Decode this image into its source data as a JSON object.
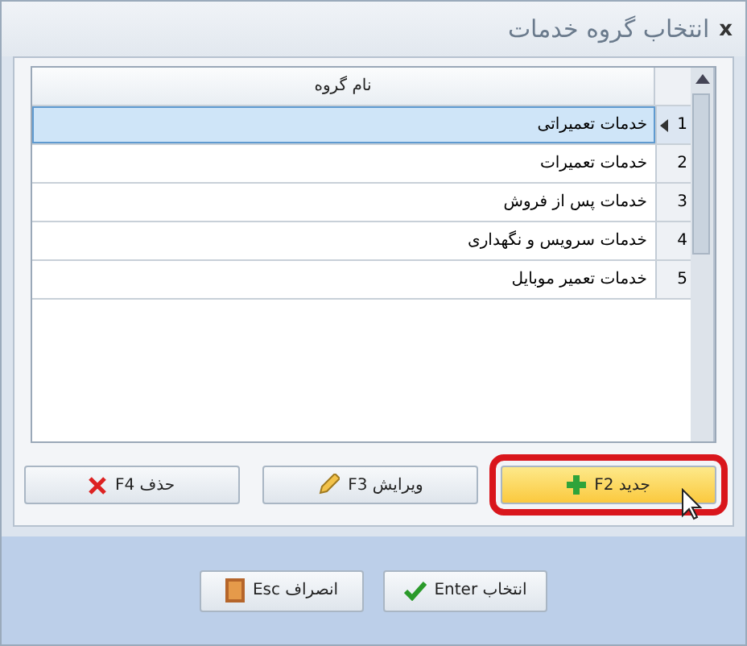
{
  "window": {
    "title": "انتخاب گروه خدمات",
    "close": "x"
  },
  "table": {
    "columns": [
      "نام گروه"
    ],
    "rows": [
      {
        "number": "1",
        "name": "خدمات تعمیراتی",
        "selected": true
      },
      {
        "number": "2",
        "name": "خدمات تعمیرات",
        "selected": false
      },
      {
        "number": "3",
        "name": "خدمات پس از فروش",
        "selected": false
      },
      {
        "number": "4",
        "name": "خدمات سرویس و نگهداری",
        "selected": false
      },
      {
        "number": "5",
        "name": "خدمات تعمیر موبایل",
        "selected": false
      }
    ]
  },
  "actions": [
    {
      "kind": "add",
      "label": "جدید F2",
      "highlighted": true
    },
    {
      "kind": "edit",
      "label": "ویرایش F3",
      "highlighted": false
    },
    {
      "kind": "delete",
      "label": "حذف F4",
      "highlighted": false
    }
  ],
  "footer": [
    {
      "kind": "select",
      "label": "انتخاب Enter"
    },
    {
      "kind": "cancel",
      "label": "انصراف Esc"
    }
  ]
}
